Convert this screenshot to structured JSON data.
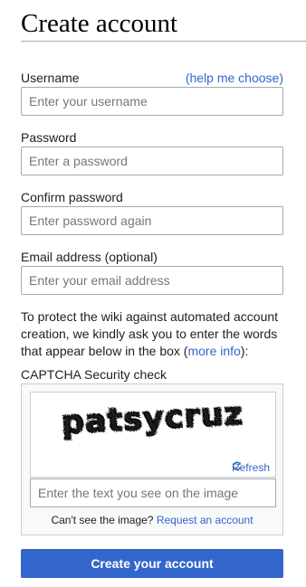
{
  "page": {
    "title": "Create account"
  },
  "form": {
    "username": {
      "label": "Username",
      "help_link": "(help me choose)",
      "placeholder": "Enter your username"
    },
    "password": {
      "label": "Password",
      "placeholder": "Enter a password"
    },
    "confirm_password": {
      "label": "Confirm password",
      "placeholder": "Enter password again"
    },
    "email": {
      "label": "Email address (optional)",
      "placeholder": "Enter your email address"
    }
  },
  "captcha": {
    "note_prefix": "To protect the wiki against automated account creation, we kindly ask you to enter the words that appear below in the box (",
    "note_link": "more info",
    "note_suffix": "):",
    "section_label": "CAPTCHA Security check",
    "image_text": "patsycruz",
    "refresh_label": "Refresh",
    "refresh_icon": "refresh-icon",
    "input_placeholder": "Enter the text you see on the image",
    "cant_see_text": "Can't see the image?",
    "request_link": "Request an account"
  },
  "submit": {
    "label": "Create your account"
  },
  "colors": {
    "accent": "#3366cc",
    "border": "#a2a9b1",
    "panel_bg": "#f8f9fa",
    "text": "#202122"
  }
}
